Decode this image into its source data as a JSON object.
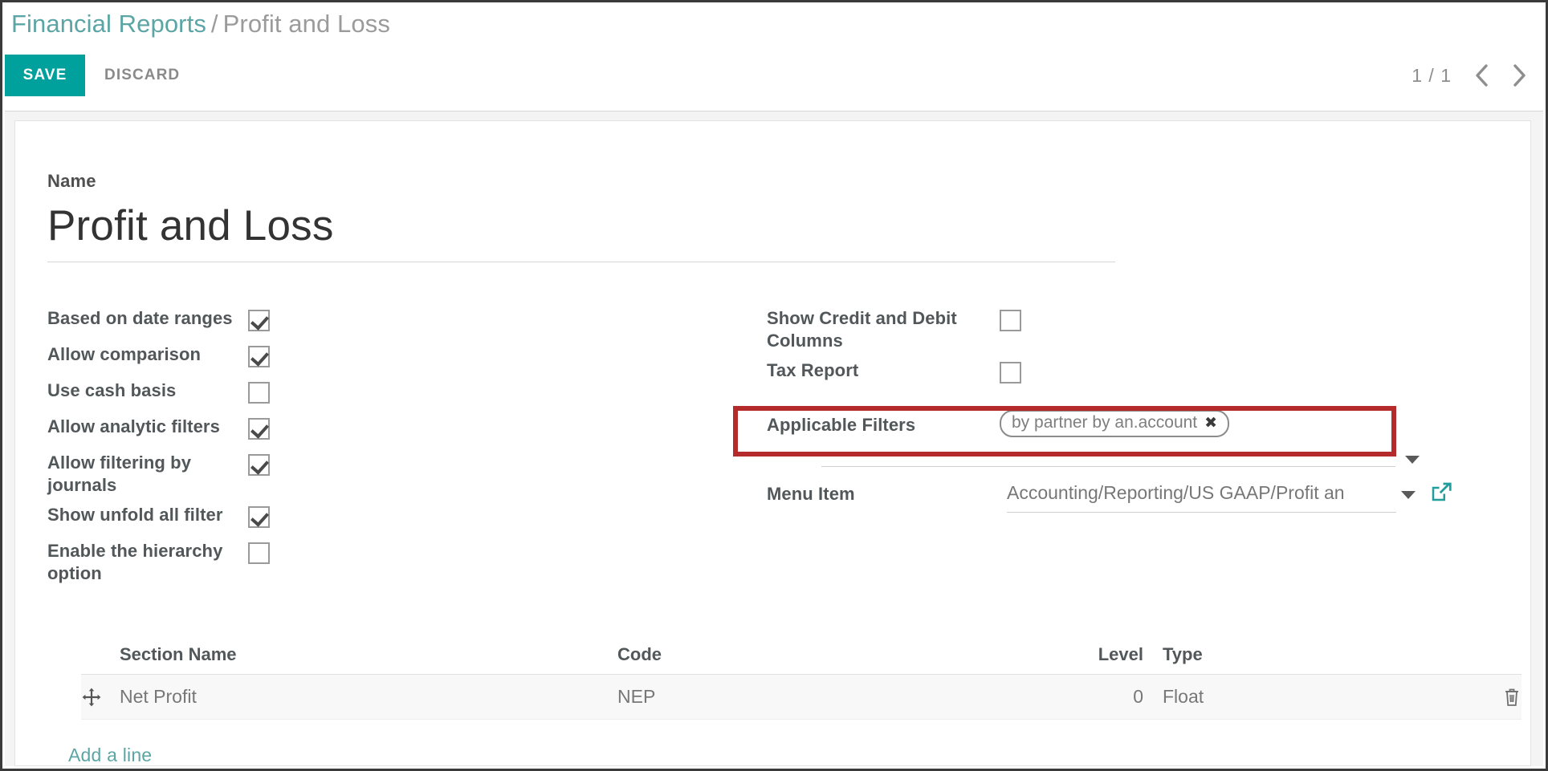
{
  "breadcrumb": {
    "parent": "Financial Reports",
    "separator": "/",
    "current": "Profit and Loss"
  },
  "toolbar": {
    "save_label": "SAVE",
    "discard_label": "DISCARD"
  },
  "pager": {
    "count": "1 / 1",
    "prev_icon": "chevron-left-icon",
    "next_icon": "chevron-right-icon"
  },
  "form": {
    "name_label": "Name",
    "name_value": "Profit and Loss",
    "left_column": [
      {
        "label": "Based on date ranges",
        "checked": true
      },
      {
        "label": "Allow comparison",
        "checked": true
      },
      {
        "label": "Use cash basis",
        "checked": false
      },
      {
        "label": "Allow analytic filters",
        "checked": true
      },
      {
        "label": "Allow filtering by journals",
        "checked": true
      },
      {
        "label": "Show unfold all filter",
        "checked": true
      },
      {
        "label": "Enable the hierarchy option",
        "checked": false
      }
    ],
    "right_column": [
      {
        "label": "Show Credit and Debit Columns",
        "checked": false
      },
      {
        "label": "Tax Report",
        "checked": false
      }
    ],
    "applicable_filters": {
      "label": "Applicable Filters",
      "tag": "by partner by an.account",
      "tag_remove_icon": "close-icon",
      "dropdown_icon": "caret-down-icon",
      "highlight_color": "#b52b2b"
    },
    "menu_item": {
      "label": "Menu Item",
      "value": "Accounting/Reporting/US GAAP/Profit an",
      "dropdown_icon": "caret-down-icon",
      "external_link_icon": "external-link-icon"
    }
  },
  "table": {
    "columns": {
      "section_name": "Section Name",
      "code": "Code",
      "level": "Level",
      "type": "Type"
    },
    "rows": [
      {
        "handle_icon": "drag-move-icon",
        "section_name": "Net Profit",
        "code": "NEP",
        "level": "0",
        "type": "Float",
        "delete_icon": "trash-icon"
      }
    ],
    "add_line_label": "Add a line"
  },
  "colors": {
    "accent": "#00a09d",
    "breadcrumb_parent": "#5ba6a5",
    "highlight": "#b52b2b",
    "link": "#5ba6a5"
  }
}
